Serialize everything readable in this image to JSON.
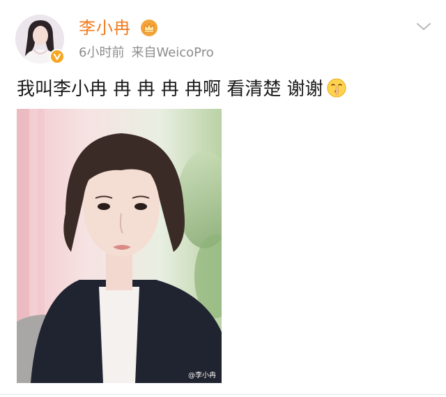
{
  "post": {
    "author": {
      "name": "李小冉",
      "badge_icon": "crown-icon",
      "verified_icon": "verified-icon"
    },
    "meta": {
      "time": "6小时前",
      "source": "来自WeicoPro"
    },
    "text": "我叫李小冉 冉 冉 冉 冉啊 看清楚 谢谢",
    "emoji": "shushing-face-icon",
    "photo": {
      "watermark": "@李小冉"
    },
    "more_icon": "chevron-down-icon"
  },
  "colors": {
    "username": "#f07a1d",
    "meta": "#8c8c8c",
    "text": "#1a1a1a",
    "verified": "#f5a623",
    "chevron": "#b8b8b8"
  }
}
